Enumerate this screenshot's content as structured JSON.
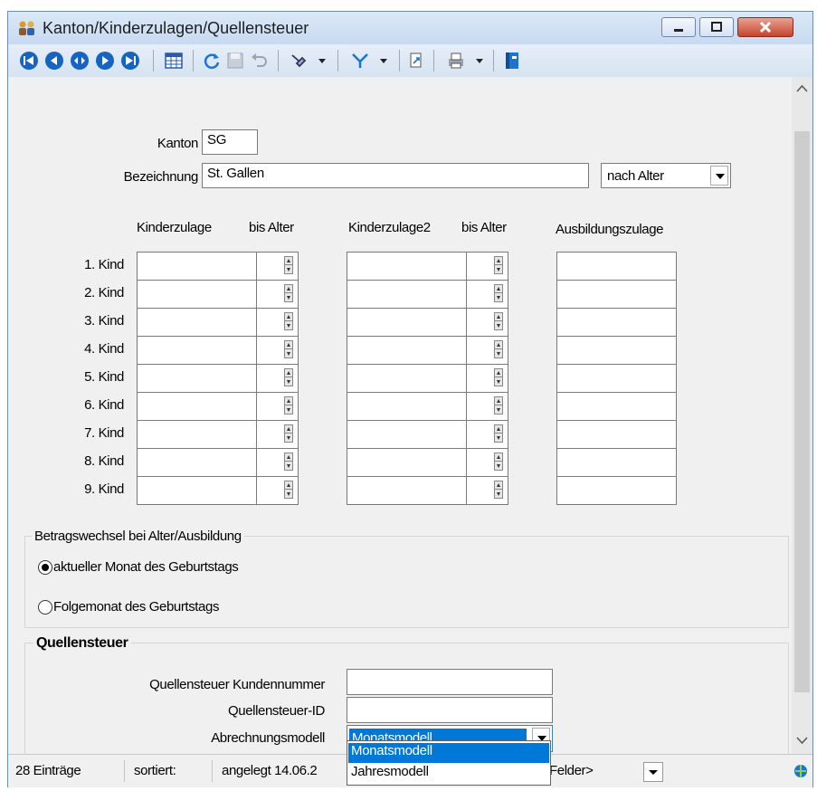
{
  "window": {
    "title": "Kanton/Kinderzulagen/Quellensteuer"
  },
  "toolbar": {
    "icons": [
      "first-record-icon",
      "previous-record-icon",
      "go-to-record-icon",
      "next-record-icon",
      "last-record-icon",
      "table-view-icon",
      "refresh-icon",
      "save-icon",
      "undo-icon",
      "pin-icon",
      "filter-icon",
      "export-icon",
      "print-icon",
      "book-icon"
    ]
  },
  "form": {
    "kanton_label": "Kanton",
    "kanton_value": "SG",
    "bezeichnung_label": "Bezeichnung",
    "bezeichnung_value": "St. Gallen",
    "age_mode": "nach Alter",
    "col_kinderzulage": "Kinderzulage",
    "col_bis_alter": "bis Alter",
    "col_kinderzulage2": "Kinderzulage2",
    "col_bis_alter2": "bis Alter",
    "col_ausbildungszulage": "Ausbildungszulage",
    "kinder": [
      "1. Kind",
      "2. Kind",
      "3. Kind",
      "4. Kind",
      "5. Kind",
      "6. Kind",
      "7. Kind",
      "8. Kind",
      "9. Kind"
    ]
  },
  "betragswechsel": {
    "legend": "Betragswechsel bei Alter/Ausbildung",
    "option1": "aktueller Monat des Geburtstags",
    "option2": "Folgemonat des Geburtstags",
    "selected": "option1"
  },
  "quellensteuer": {
    "legend": "Quellensteuer",
    "kundennummer_label": "Quellensteuer Kundennummer",
    "kundennummer_value": "",
    "id_label": "Quellensteuer-ID",
    "id_value": "",
    "abrechnungsmodell_label": "Abrechnungsmodell",
    "abrechnungsmodell_value": "Monatsmodell",
    "options": [
      "Monatsmodell",
      "Jahresmodell"
    ]
  },
  "status": {
    "entries": "28 Einträge",
    "sorted": "sortiert:",
    "created": "angelegt 14.06.2",
    "fields": "Felder>"
  },
  "colors": {
    "titlebar": "#c7daf1",
    "close": "#c7432a",
    "selection": "#0078d7"
  }
}
